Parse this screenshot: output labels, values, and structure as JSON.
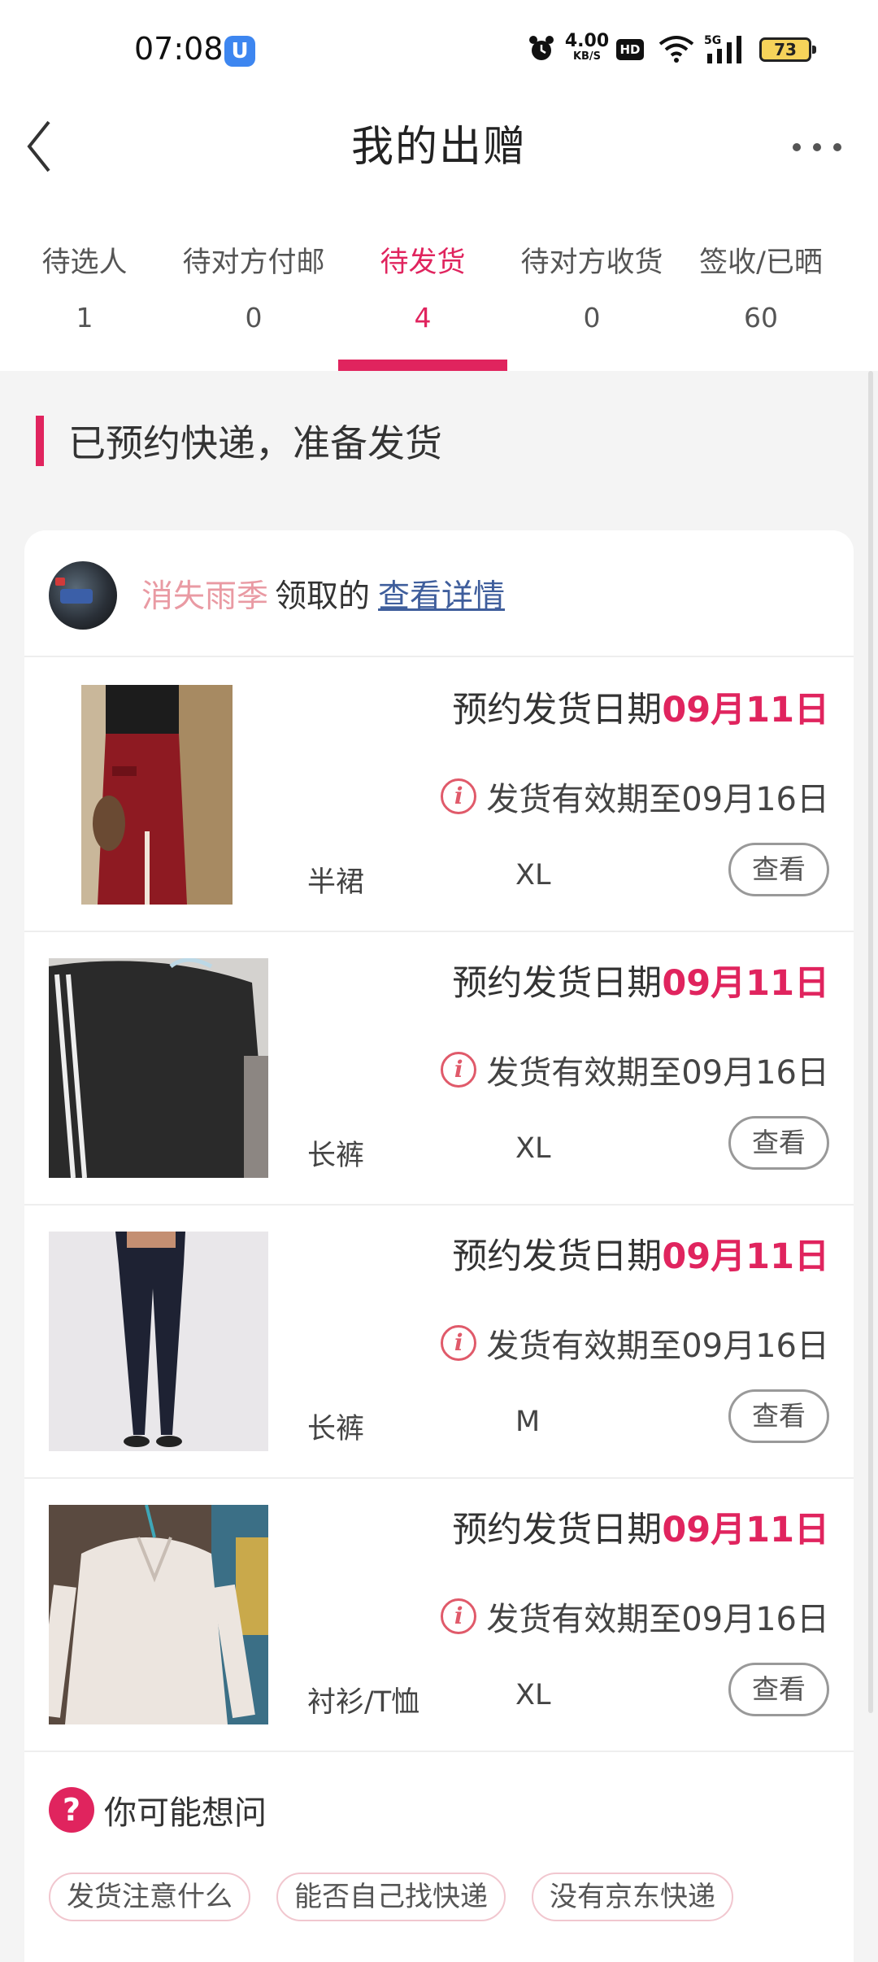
{
  "status_bar": {
    "time": "07:08",
    "app_icon_glyph": "U",
    "net_speed_value": "4.00",
    "net_speed_unit": "KB/S",
    "hd_label": "HD",
    "signal_label": "5G",
    "battery": "73"
  },
  "nav": {
    "title": "我的出赠"
  },
  "tabs": [
    {
      "label": "待选人",
      "count": "1"
    },
    {
      "label": "待对方付邮",
      "count": "0"
    },
    {
      "label": "待发货",
      "count": "4",
      "active": true
    },
    {
      "label": "待对方收货",
      "count": "0"
    },
    {
      "label": "签收/已晒",
      "count": "60"
    }
  ],
  "section": {
    "heading": "已预约快递，准备发货"
  },
  "receiver": {
    "name": "消失雨季",
    "action": "领取的",
    "link": "查看详情"
  },
  "items": [
    {
      "ship_label": "预约发货日期",
      "ship_date": "09月11日",
      "valid_text": "发货有效期至09月16日",
      "category": "半裙",
      "size": "XL",
      "view_label": "查看",
      "image": "red-skirt"
    },
    {
      "ship_label": "预约发货日期",
      "ship_date": "09月11日",
      "valid_text": "发货有效期至09月16日",
      "category": "长裤",
      "size": "XL",
      "view_label": "查看",
      "image": "black-striped-pants"
    },
    {
      "ship_label": "预约发货日期",
      "ship_date": "09月11日",
      "valid_text": "发货有效期至09月16日",
      "category": "长裤",
      "size": "M",
      "view_label": "查看",
      "image": "navy-leggings"
    },
    {
      "ship_label": "预约发货日期",
      "ship_date": "09月11日",
      "valid_text": "发货有效期至09月16日",
      "category": "衬衫/T恤",
      "size": "XL",
      "view_label": "查看",
      "image": "white-shirt"
    }
  ],
  "faq": {
    "icon_glyph": "?",
    "title": "你可能想问",
    "chips": [
      "发货注意什么",
      "能否自己找快递",
      "没有京东快递"
    ]
  },
  "colors": {
    "accent": "#e0245e",
    "receiver_name": "#e99aa3",
    "link": "#3f5e9c"
  }
}
